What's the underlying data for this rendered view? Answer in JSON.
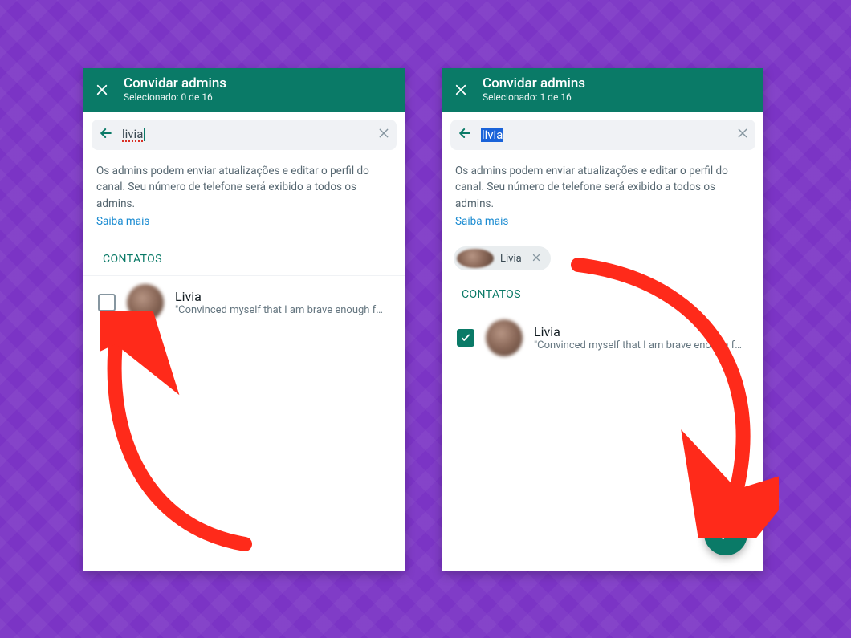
{
  "colors": {
    "teal": "#0a7a67",
    "purple": "#7b34c5",
    "arrow": "#ff2a1a"
  },
  "left": {
    "header": {
      "title": "Convidar admins",
      "subtitle": "Selecionado: 0 de 16"
    },
    "search": {
      "value": "livia"
    },
    "info": {
      "text": "Os admins podem enviar atualizações e editar o perfil do canal. Seu número de telefone será exibido a todos os admins.",
      "learn_more": "Saiba mais"
    },
    "section_label": "CONTATOS",
    "contact": {
      "name": "Livia",
      "status": "\"Convinced myself that I am brave enough f…",
      "checked": false
    }
  },
  "right": {
    "header": {
      "title": "Convidar admins",
      "subtitle": "Selecionado: 1 de 16"
    },
    "search": {
      "value": "livia"
    },
    "info": {
      "text": "Os admins podem enviar atualizações e editar o perfil do canal. Seu número de telefone será exibido a todos os admins.",
      "learn_more": "Saiba mais"
    },
    "chip": {
      "name": "Livia"
    },
    "section_label": "CONTATOS",
    "contact": {
      "name": "Livia",
      "status": "\"Convinced myself that I am brave enough f…",
      "checked": true
    }
  }
}
